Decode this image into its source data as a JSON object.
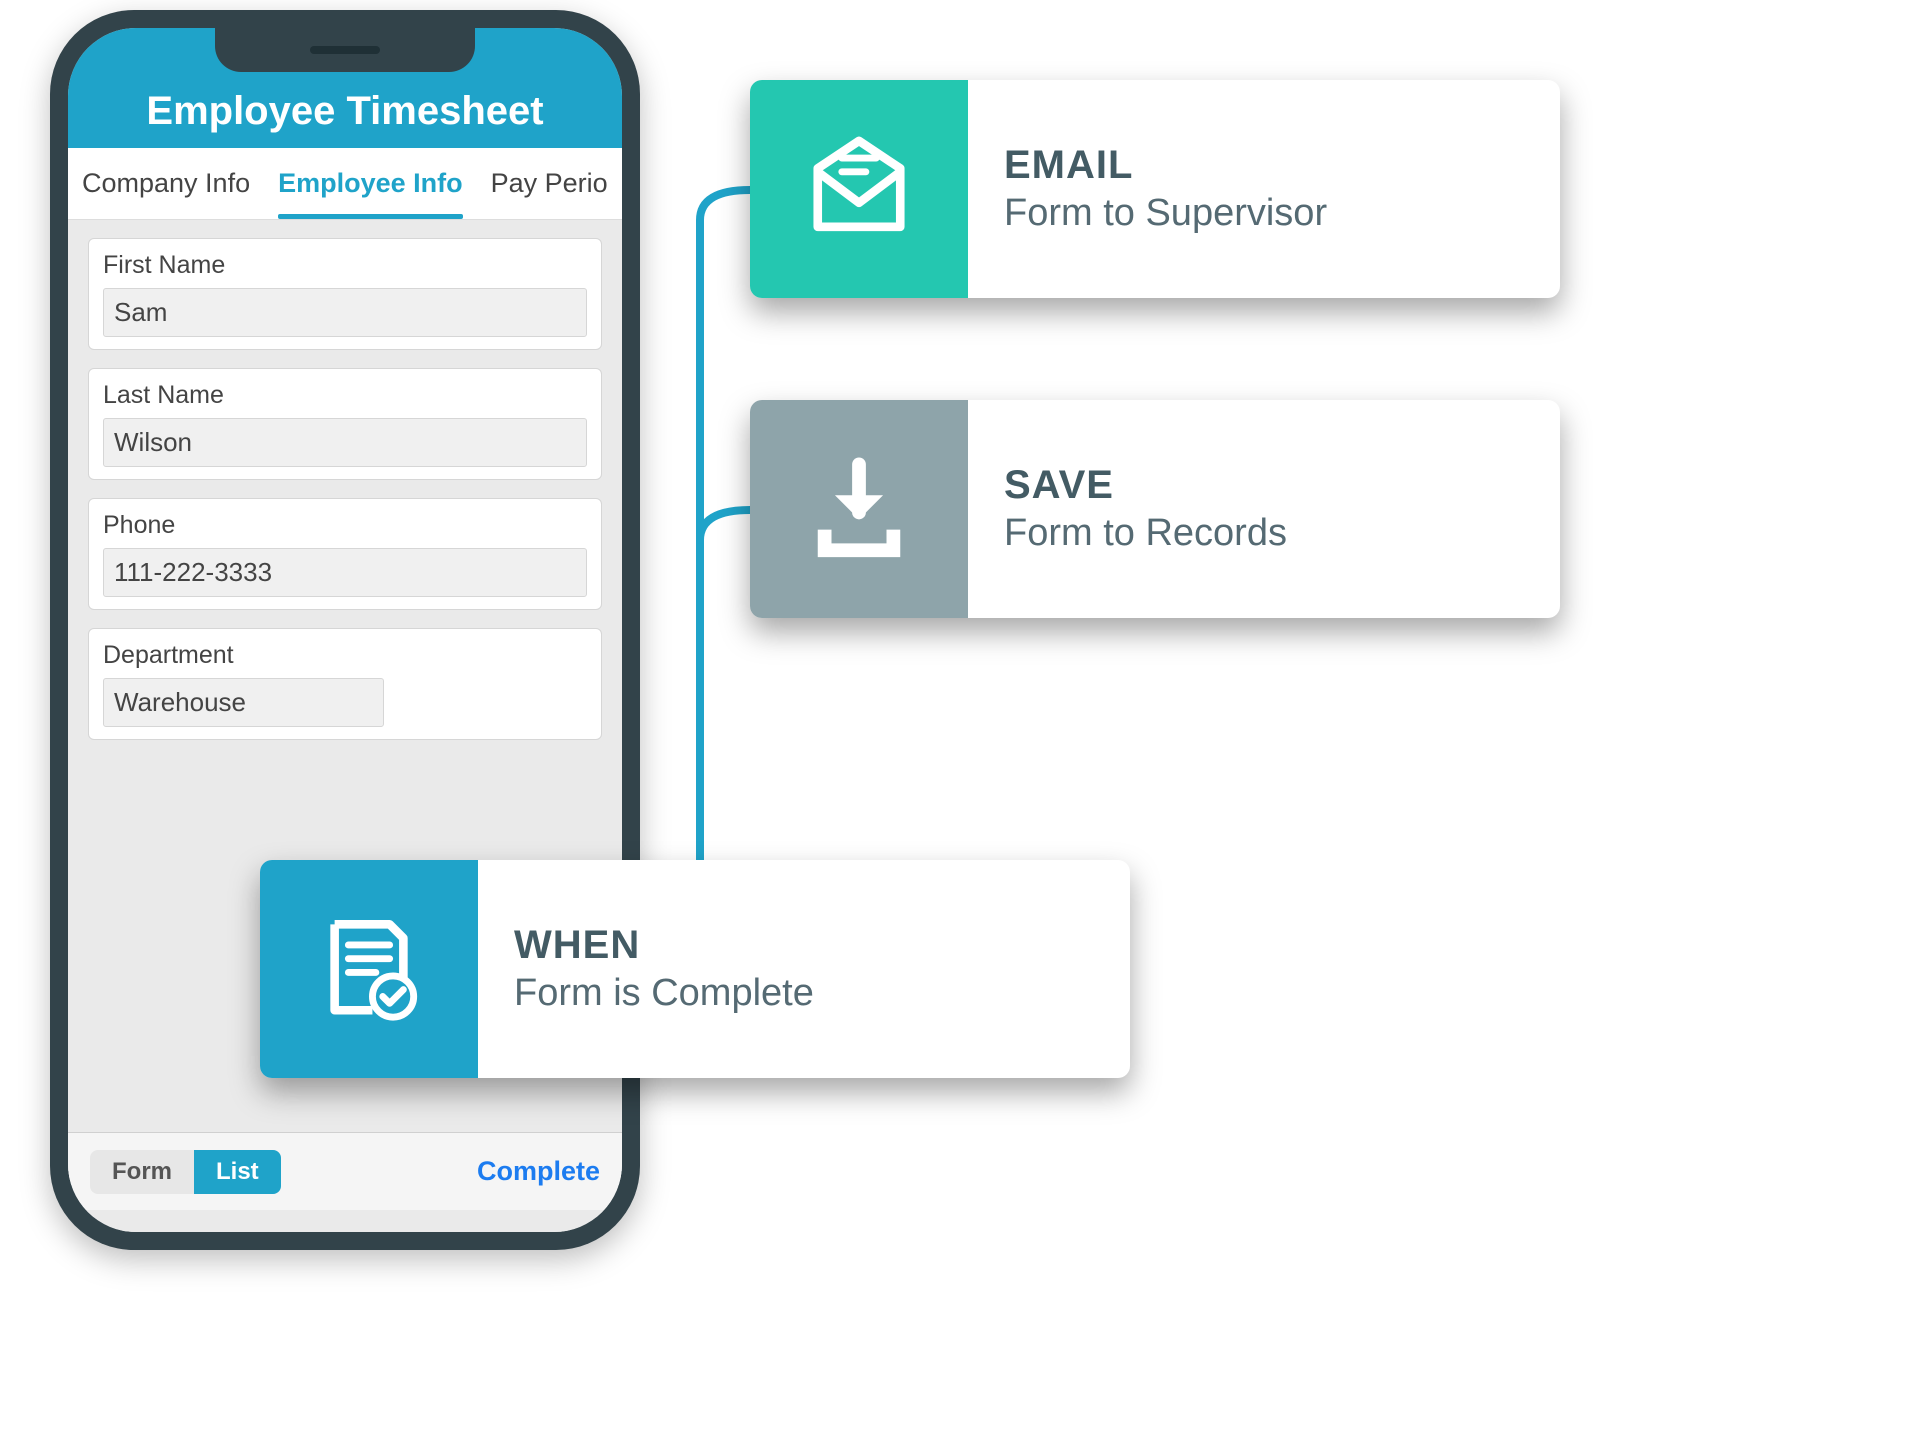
{
  "phone": {
    "header_title": "Employee Timesheet",
    "tabs": [
      {
        "label": "Company Info",
        "active": false
      },
      {
        "label": "Employee Info",
        "active": true
      },
      {
        "label": "Pay Perio",
        "active": false
      }
    ],
    "fields": [
      {
        "label": "First Name",
        "value": "Sam"
      },
      {
        "label": "Last Name",
        "value": "Wilson"
      },
      {
        "label": "Phone",
        "value": "111-222-3333"
      },
      {
        "label": "Department",
        "value": "Warehouse"
      }
    ],
    "bottom": {
      "seg_form": "Form",
      "seg_list": "List",
      "complete": "Complete"
    }
  },
  "cards": {
    "email": {
      "icon": "email-icon",
      "title": "EMAIL",
      "sub": "Form to Supervisor",
      "color": "#24c7b0"
    },
    "save": {
      "icon": "download-icon",
      "title": "SAVE",
      "sub": "Form to Records",
      "color": "#8ea4aa"
    },
    "when": {
      "icon": "form-check-icon",
      "title": "WHEN",
      "sub": "Form is Complete",
      "color": "#1fa3c9"
    }
  }
}
